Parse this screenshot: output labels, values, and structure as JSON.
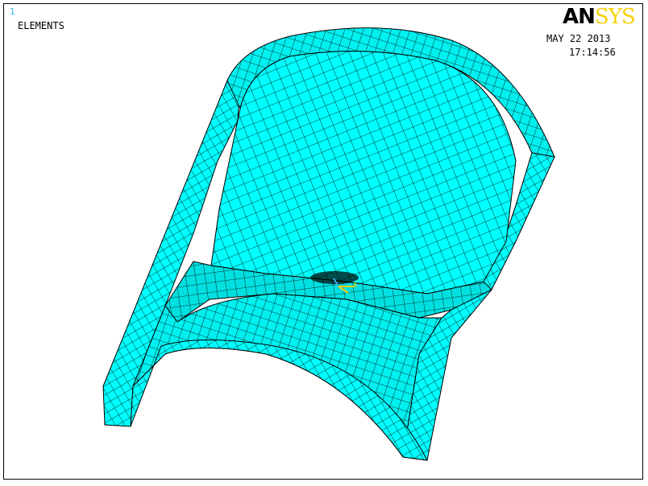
{
  "window": {
    "number": "1"
  },
  "plot": {
    "label": "ELEMENTS"
  },
  "logo": {
    "part1": "AN",
    "part2": "SYS"
  },
  "timestamp": {
    "date": "MAY 22 2013",
    "time": "17:14:56"
  },
  "triad": {
    "x_label": "X",
    "y_label": "Y",
    "z_label": "Z"
  },
  "colors": {
    "mesh_fill": "#00ffff",
    "mesh_dark": "#00d6d6",
    "mesh_line": "#000000",
    "background": "#ffffff",
    "logo_accent": "#f5d10a",
    "triad_x": "#f5d10a",
    "triad_y": "#3bb0e8"
  }
}
